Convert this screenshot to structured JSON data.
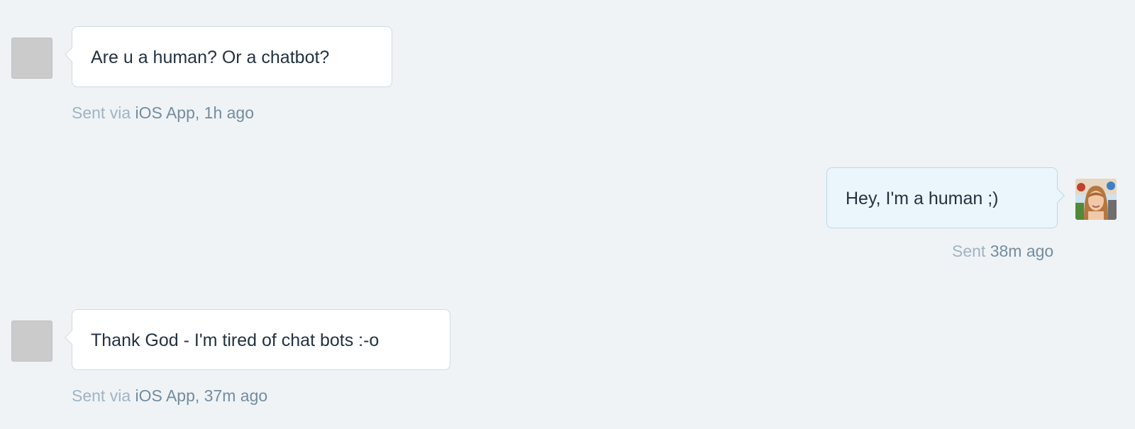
{
  "messages": [
    {
      "sender": "contact",
      "text": "Are u a human? Or a chatbot?",
      "meta_prefix": "Sent via ",
      "meta_source": "iOS App",
      "meta_time": ", 1h ago"
    },
    {
      "sender": "agent",
      "text": "Hey, I'm a human ;)",
      "meta_prefix": "Sent ",
      "meta_time": "38m ago"
    },
    {
      "sender": "contact",
      "text": "Thank God - I'm tired of chat bots :-o",
      "meta_prefix": "Sent via ",
      "meta_source": "iOS App",
      "meta_time": ", 37m ago"
    }
  ],
  "colors": {
    "background": "#eff3f6",
    "contact_bubble": "#ffffff",
    "agent_bubble": "#ebf6fc",
    "message_text": "#243240",
    "meta_muted": "#9fb4c3",
    "meta_strong": "#738c9d"
  }
}
